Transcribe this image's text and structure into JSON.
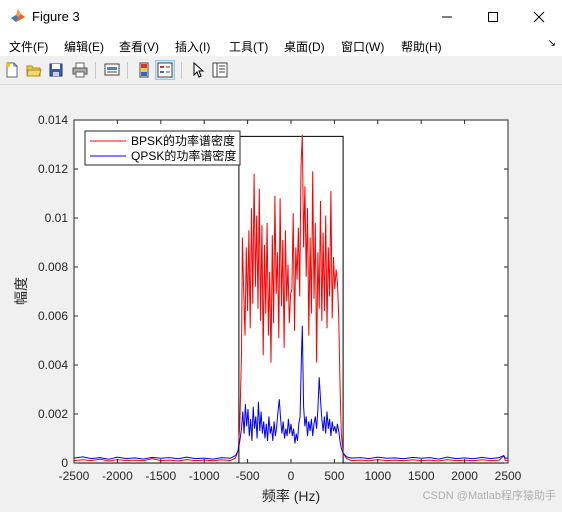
{
  "window": {
    "title": "Figure 3",
    "controls": [
      "minimize",
      "maximize",
      "close"
    ]
  },
  "menu": {
    "items": [
      "文件(F)",
      "编辑(E)",
      "查看(V)",
      "插入(I)",
      "工具(T)",
      "桌面(D)",
      "窗口(W)",
      "帮助(H)"
    ],
    "dock_arrow": "↘"
  },
  "toolbar": {
    "icons": [
      "new-figure-icon",
      "open-file-icon",
      "save-icon",
      "print-icon",
      "link-plot-icon",
      "insert-colorbar-icon",
      "insert-legend-icon",
      "edit-plot-arrow-icon",
      "property-inspector-icon"
    ]
  },
  "colors": {
    "bpsk": "#ff0000",
    "qpsk": "#0000ff",
    "rect": "#000000",
    "axes_bg": "#ffffff"
  },
  "chart_data": {
    "type": "line",
    "xlabel": "频率 (Hz)",
    "ylabel": "幅度",
    "xlim": [
      -2500,
      2500
    ],
    "ylim": [
      0,
      0.014
    ],
    "xticks": [
      -2500,
      -2000,
      -1500,
      -1000,
      -500,
      0,
      500,
      1000,
      1500,
      2000,
      2500
    ],
    "yticks": [
      0,
      0.002,
      0.004,
      0.006,
      0.008,
      0.01,
      0.012,
      0.014
    ],
    "ytick_labels": [
      "0",
      "0.002",
      "0.004",
      "0.006",
      "0.008",
      "0.01",
      "0.012",
      "0.014"
    ],
    "grid": false,
    "legend_position": "top-left",
    "series": [
      {
        "name": "BPSK的功率谱密度",
        "color": "#ff0000",
        "points": [
          [
            -2500,
            0.0001
          ],
          [
            -2400,
            0.00013
          ],
          [
            -2300,
            0.0001
          ],
          [
            -2200,
            0.00016
          ],
          [
            -2100,
            8e-05
          ],
          [
            -2000,
            0.00014
          ],
          [
            -1900,
            0.0001
          ],
          [
            -1800,
            0.00012
          ],
          [
            -1700,
            9e-05
          ],
          [
            -1600,
            0.00018
          ],
          [
            -1500,
            0.0001
          ],
          [
            -1400,
            0.00012
          ],
          [
            -1300,
            8e-05
          ],
          [
            -1200,
            0.00014
          ],
          [
            -1100,
            0.0001
          ],
          [
            -1000,
            0.00012
          ],
          [
            -900,
            9e-05
          ],
          [
            -800,
            0.00013
          ],
          [
            -700,
            0.0001
          ],
          [
            -640,
            0.0002
          ],
          [
            -610,
            0.0005
          ],
          [
            -590,
            0.0015
          ],
          [
            -570,
            0.0045
          ],
          [
            -560,
            0.0092
          ],
          [
            -545,
            0.007
          ],
          [
            -530,
            0.0052
          ],
          [
            -515,
            0.0088
          ],
          [
            -500,
            0.0062
          ],
          [
            -485,
            0.0095
          ],
          [
            -470,
            0.0055
          ],
          [
            -455,
            0.0104
          ],
          [
            -440,
            0.0065
          ],
          [
            -425,
            0.0118
          ],
          [
            -410,
            0.0072
          ],
          [
            -395,
            0.0101
          ],
          [
            -380,
            0.0063
          ],
          [
            -365,
            0.0112
          ],
          [
            -350,
            0.0058
          ],
          [
            -335,
            0.0097
          ],
          [
            -320,
            0.0044
          ],
          [
            -305,
            0.0089
          ],
          [
            -290,
            0.0061
          ],
          [
            -275,
            0.0098
          ],
          [
            -260,
            0.0052
          ],
          [
            -245,
            0.0078
          ],
          [
            -230,
            0.0041
          ],
          [
            -215,
            0.0093
          ],
          [
            -200,
            0.0057
          ],
          [
            -185,
            0.0109
          ],
          [
            -170,
            0.0069
          ],
          [
            -155,
            0.0086
          ],
          [
            -140,
            0.0051
          ],
          [
            -125,
            0.0108
          ],
          [
            -110,
            0.0064
          ],
          [
            -95,
            0.0091
          ],
          [
            -80,
            0.0047
          ],
          [
            -65,
            0.0095
          ],
          [
            -50,
            0.0066
          ],
          [
            -35,
            0.0081
          ],
          [
            -20,
            0.0057
          ],
          [
            -5,
            0.0069
          ],
          [
            10,
            0.0071
          ],
          [
            25,
            0.0102
          ],
          [
            40,
            0.0054
          ],
          [
            55,
            0.0088
          ],
          [
            70,
            0.0075
          ],
          [
            85,
            0.0096
          ],
          [
            100,
            0.0068
          ],
          [
            115,
            0.0121
          ],
          [
            130,
            0.0134
          ],
          [
            145,
            0.0088
          ],
          [
            160,
            0.0113
          ],
          [
            175,
            0.0076
          ],
          [
            190,
            0.0104
          ],
          [
            205,
            0.0052
          ],
          [
            220,
            0.0092
          ],
          [
            235,
            0.0061
          ],
          [
            250,
            0.0119
          ],
          [
            265,
            0.0067
          ],
          [
            280,
            0.0098
          ],
          [
            295,
            0.0041
          ],
          [
            310,
            0.0086
          ],
          [
            325,
            0.0063
          ],
          [
            340,
            0.0107
          ],
          [
            355,
            0.0058
          ],
          [
            370,
            0.0094
          ],
          [
            385,
            0.0062
          ],
          [
            400,
            0.0101
          ],
          [
            415,
            0.0055
          ],
          [
            430,
            0.0088
          ],
          [
            445,
            0.0068
          ],
          [
            460,
            0.0111
          ],
          [
            475,
            0.0059
          ],
          [
            490,
            0.0084
          ],
          [
            505,
            0.0071
          ],
          [
            520,
            0.0079
          ],
          [
            535,
            0.0074
          ],
          [
            550,
            0.006
          ],
          [
            565,
            0.0032
          ],
          [
            580,
            0.0012
          ],
          [
            600,
            0.0004
          ],
          [
            640,
            0.00018
          ],
          [
            700,
            0.0001
          ],
          [
            800,
            0.00012
          ],
          [
            900,
            9e-05
          ],
          [
            1000,
            0.00014
          ],
          [
            1100,
            0.0001
          ],
          [
            1200,
            0.00012
          ],
          [
            1300,
            9e-05
          ],
          [
            1400,
            0.00013
          ],
          [
            1500,
            0.0001
          ],
          [
            1600,
            0.00012
          ],
          [
            1700,
            8e-05
          ],
          [
            1800,
            0.00014
          ],
          [
            1900,
            0.0001
          ],
          [
            2000,
            0.00012
          ],
          [
            2100,
            9e-05
          ],
          [
            2200,
            0.00013
          ],
          [
            2300,
            0.0001
          ],
          [
            2400,
            0.00012
          ],
          [
            2450,
            0.0003
          ],
          [
            2470,
            0.0001
          ],
          [
            2500,
            0.0001
          ]
        ]
      },
      {
        "name": "QPSK的功率谱密度",
        "color": "#0000ff",
        "points": [
          [
            -2500,
            0.0002
          ],
          [
            -2400,
            0.00025
          ],
          [
            -2300,
            0.00018
          ],
          [
            -2200,
            0.00022
          ],
          [
            -2100,
            0.00015
          ],
          [
            -2000,
            0.00024
          ],
          [
            -1900,
            0.00018
          ],
          [
            -1800,
            0.00021
          ],
          [
            -1700,
            0.00016
          ],
          [
            -1600,
            0.00023
          ],
          [
            -1500,
            0.00019
          ],
          [
            -1400,
            0.00022
          ],
          [
            -1300,
            0.00017
          ],
          [
            -1200,
            0.00024
          ],
          [
            -1100,
            0.00018
          ],
          [
            -1000,
            0.0002
          ],
          [
            -900,
            0.00016
          ],
          [
            -800,
            0.00022
          ],
          [
            -700,
            0.00019
          ],
          [
            -640,
            0.0003
          ],
          [
            -610,
            0.0005
          ],
          [
            -590,
            0.0009
          ],
          [
            -570,
            0.0014
          ],
          [
            -555,
            0.0021
          ],
          [
            -540,
            0.0012
          ],
          [
            -525,
            0.0024
          ],
          [
            -510,
            0.0015
          ],
          [
            -495,
            0.0022
          ],
          [
            -480,
            0.0011
          ],
          [
            -465,
            0.0018
          ],
          [
            -450,
            0.0009
          ],
          [
            -435,
            0.0023
          ],
          [
            -420,
            0.0014
          ],
          [
            -405,
            0.0019
          ],
          [
            -390,
            0.001
          ],
          [
            -375,
            0.0025
          ],
          [
            -360,
            0.0013
          ],
          [
            -345,
            0.0021
          ],
          [
            -330,
            0.0012
          ],
          [
            -315,
            0.0017
          ],
          [
            -300,
            0.001
          ],
          [
            -285,
            0.0016
          ],
          [
            -270,
            0.0009
          ],
          [
            -255,
            0.0019
          ],
          [
            -240,
            0.0012
          ],
          [
            -225,
            0.0015
          ],
          [
            -210,
            0.0009
          ],
          [
            -195,
            0.0017
          ],
          [
            -180,
            0.0011
          ],
          [
            -165,
            0.0015
          ],
          [
            -150,
            0.0021
          ],
          [
            -135,
            0.0026
          ],
          [
            -120,
            0.0018
          ],
          [
            -105,
            0.0012
          ],
          [
            -90,
            0.0017
          ],
          [
            -75,
            0.001
          ],
          [
            -60,
            0.0014
          ],
          [
            -45,
            0.0011
          ],
          [
            -30,
            0.0018
          ],
          [
            -15,
            0.0012
          ],
          [
            0,
            0.0016
          ],
          [
            15,
            0.0011
          ],
          [
            30,
            0.0014
          ],
          [
            45,
            0.0008
          ],
          [
            60,
            0.0012
          ],
          [
            75,
            0.0009
          ],
          [
            90,
            0.0016
          ],
          [
            105,
            0.0019
          ],
          [
            120,
            0.0043
          ],
          [
            130,
            0.0056
          ],
          [
            145,
            0.0023
          ],
          [
            160,
            0.0015
          ],
          [
            175,
            0.0019
          ],
          [
            190,
            0.0011
          ],
          [
            205,
            0.0017
          ],
          [
            220,
            0.0013
          ],
          [
            235,
            0.0018
          ],
          [
            250,
            0.0011
          ],
          [
            265,
            0.0016
          ],
          [
            280,
            0.0019
          ],
          [
            295,
            0.0014
          ],
          [
            310,
            0.0022
          ],
          [
            325,
            0.0035
          ],
          [
            340,
            0.0026
          ],
          [
            355,
            0.0018
          ],
          [
            370,
            0.0013
          ],
          [
            385,
            0.0019
          ],
          [
            400,
            0.0012
          ],
          [
            415,
            0.0021
          ],
          [
            430,
            0.0014
          ],
          [
            445,
            0.0018
          ],
          [
            460,
            0.0011
          ],
          [
            475,
            0.0017
          ],
          [
            490,
            0.0013
          ],
          [
            505,
            0.0015
          ],
          [
            520,
            0.0012
          ],
          [
            535,
            0.0016
          ],
          [
            550,
            0.0013
          ],
          [
            565,
            0.0009
          ],
          [
            580,
            0.0006
          ],
          [
            600,
            0.0004
          ],
          [
            640,
            0.00025
          ],
          [
            700,
            0.0002
          ],
          [
            800,
            0.00022
          ],
          [
            900,
            0.00018
          ],
          [
            1000,
            0.00024
          ],
          [
            1100,
            0.00019
          ],
          [
            1200,
            0.00021
          ],
          [
            1300,
            0.00017
          ],
          [
            1400,
            0.00023
          ],
          [
            1500,
            0.00019
          ],
          [
            1600,
            0.00022
          ],
          [
            1700,
            0.00016
          ],
          [
            1800,
            0.00024
          ],
          [
            1900,
            0.00018
          ],
          [
            2000,
            0.00021
          ],
          [
            2100,
            0.00017
          ],
          [
            2200,
            0.00023
          ],
          [
            2300,
            0.00018
          ],
          [
            2400,
            0.00022
          ],
          [
            2450,
            0.0003
          ],
          [
            2470,
            0.0002
          ],
          [
            2500,
            0.0002
          ]
        ]
      },
      {
        "name": "",
        "color": "#000000",
        "points": [
          [
            -2500,
            0
          ],
          [
            -600,
            0
          ],
          [
            -600,
            0.01333
          ],
          [
            600,
            0.01333
          ],
          [
            600,
            0
          ],
          [
            2500,
            0
          ]
        ]
      }
    ]
  },
  "watermark": "CSDN @Matlab程序猿助手"
}
